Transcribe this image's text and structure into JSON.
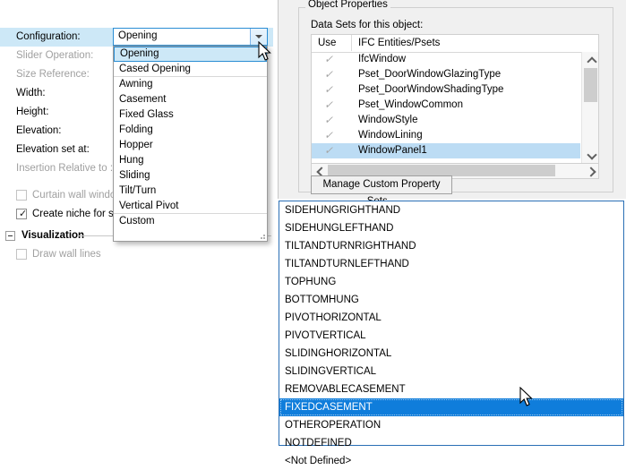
{
  "left_panel": {
    "rows": [
      {
        "label": "Configuration:",
        "dim": false,
        "highlight": true
      },
      {
        "label": "Slider Operation:",
        "dim": true,
        "highlight": false
      },
      {
        "label": "Size Reference:",
        "dim": true,
        "highlight": false
      },
      {
        "label": "Width:",
        "dim": false,
        "highlight": false
      },
      {
        "label": "Height:",
        "dim": false,
        "highlight": false
      },
      {
        "label": "Elevation:",
        "dim": false,
        "highlight": false
      },
      {
        "label": "Elevation set at:",
        "dim": false,
        "highlight": false
      },
      {
        "label": "Insertion Relative to :",
        "dim": true,
        "highlight": false
      }
    ],
    "checkboxes": [
      {
        "label": "Curtain wall window",
        "checked": false,
        "dim": true
      },
      {
        "label": "Create niche for sp",
        "checked": true,
        "dim": false
      }
    ],
    "group": {
      "title": "Visualization",
      "expander": "minus"
    },
    "group_checkbox": {
      "label": "Draw wall lines",
      "checked": false,
      "dim": true
    }
  },
  "config_combo": {
    "value": "Opening",
    "dropdown_icon": "chevron-down-icon",
    "items": [
      {
        "label": "Opening",
        "selected": true,
        "separator_after": false
      },
      {
        "label": "Cased Opening",
        "selected": false,
        "separator_after": true
      },
      {
        "label": "Awning",
        "selected": false,
        "separator_after": false
      },
      {
        "label": "Casement",
        "selected": false,
        "separator_after": false
      },
      {
        "label": "Fixed Glass",
        "selected": false,
        "separator_after": false
      },
      {
        "label": "Folding",
        "selected": false,
        "separator_after": false
      },
      {
        "label": "Hopper",
        "selected": false,
        "separator_after": false
      },
      {
        "label": "Hung",
        "selected": false,
        "separator_after": false
      },
      {
        "label": "Sliding",
        "selected": false,
        "separator_after": false
      },
      {
        "label": "Tilt/Turn",
        "selected": false,
        "separator_after": false
      },
      {
        "label": "Vertical Pivot",
        "selected": false,
        "separator_after": true
      },
      {
        "label": "Custom",
        "selected": false,
        "separator_after": false
      }
    ]
  },
  "right_panel": {
    "groupbox_title": "Object Properties",
    "datasets_label": "Data Sets for this object:",
    "list": {
      "columns": [
        "Use",
        "IFC Entities/Psets"
      ],
      "rows": [
        {
          "use": "check-icon",
          "name": "IfcWindow",
          "selected": false
        },
        {
          "use": "check-icon",
          "name": "Pset_DoorWindowGlazingType",
          "selected": false
        },
        {
          "use": "check-icon",
          "name": "Pset_DoorWindowShadingType",
          "selected": false
        },
        {
          "use": "check-icon",
          "name": "Pset_WindowCommon",
          "selected": false
        },
        {
          "use": "check-icon",
          "name": "WindowStyle",
          "selected": false
        },
        {
          "use": "check-icon",
          "name": "WindowLining",
          "selected": false
        },
        {
          "use": "check-icon",
          "name": "WindowPanel1",
          "selected": true
        }
      ]
    },
    "manage_button": "Manage Custom Property Sets..."
  },
  "enum_dropdown": {
    "items": [
      {
        "label": "SIDEHUNGRIGHTHAND",
        "selected": false
      },
      {
        "label": "SIDEHUNGLEFTHAND",
        "selected": false
      },
      {
        "label": "TILTANDTURNRIGHTHAND",
        "selected": false
      },
      {
        "label": "TILTANDTURNLEFTHAND",
        "selected": false
      },
      {
        "label": "TOPHUNG",
        "selected": false
      },
      {
        "label": "BOTTOMHUNG",
        "selected": false
      },
      {
        "label": "PIVOTHORIZONTAL",
        "selected": false
      },
      {
        "label": "PIVOTVERTICAL",
        "selected": false
      },
      {
        "label": "SLIDINGHORIZONTAL",
        "selected": false
      },
      {
        "label": "SLIDINGVERTICAL",
        "selected": false
      },
      {
        "label": "REMOVABLECASEMENT",
        "selected": false
      },
      {
        "label": "FIXEDCASEMENT",
        "selected": true
      },
      {
        "label": "OTHEROPERATION",
        "selected": false
      },
      {
        "label": "NOTDEFINED",
        "selected": false
      },
      {
        "label": "<Not Defined>",
        "selected": false
      }
    ]
  },
  "colors": {
    "selection_blue": "#0f7ddb",
    "light_selection": "#cde8f7",
    "list_selection": "#bcdcf4",
    "focus_border": "#2a8dd4",
    "panel_bg": "#f0f0f0"
  }
}
